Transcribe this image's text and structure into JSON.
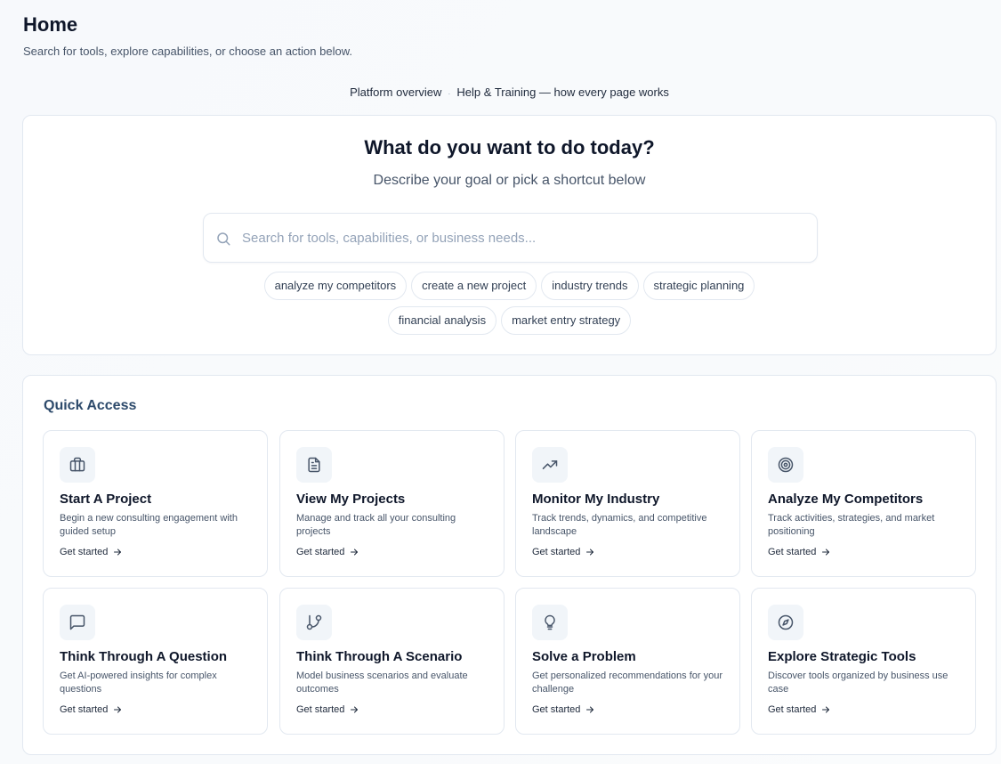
{
  "header": {
    "title": "Home",
    "subtitle": "Search for tools, explore capabilities, or choose an action below."
  },
  "top_links": [
    {
      "label": "Platform overview"
    },
    {
      "label": "Help & Training — how every page works"
    }
  ],
  "hero": {
    "title": "What do you want to do today?",
    "subtitle": "Describe your goal or pick a shortcut below",
    "search": {
      "placeholder": "Search for tools, capabilities, or business needs...",
      "value": ""
    },
    "chips_row1": [
      "analyze my competitors",
      "create a new project",
      "industry trends",
      "strategic planning"
    ],
    "chips_row2": [
      "financial analysis",
      "market entry strategy"
    ]
  },
  "quick_access": {
    "title": "Quick Access",
    "cards": [
      {
        "icon": "briefcase-icon",
        "title": "Start A Project",
        "description": "Begin a new consulting engagement with guided setup",
        "link": "Get started"
      },
      {
        "icon": "document-icon",
        "title": "View My Projects",
        "description": "Manage and track all your consulting projects",
        "link": "Get started"
      },
      {
        "icon": "trending-up-icon",
        "title": "Monitor My Industry",
        "description": "Track trends, dynamics, and competitive landscape",
        "link": "Get started"
      },
      {
        "icon": "target-icon",
        "title": "Analyze My Competitors",
        "description": "Track activities, strategies, and market positioning",
        "link": "Get started"
      },
      {
        "icon": "message-square-icon",
        "title": "Think Through A Question",
        "description": "Get AI-powered insights for complex questions",
        "link": "Get started"
      },
      {
        "icon": "git-branch-icon",
        "title": "Think Through A Scenario",
        "description": "Model business scenarios and evaluate outcomes",
        "link": "Get started"
      },
      {
        "icon": "lightbulb-icon",
        "title": "Solve a Problem",
        "description": "Get personalized recommendations for your challenge",
        "link": "Get started"
      },
      {
        "icon": "compass-icon",
        "title": "Explore Strategic Tools",
        "description": "Discover tools organized by business use case",
        "link": "Get started"
      }
    ]
  }
}
